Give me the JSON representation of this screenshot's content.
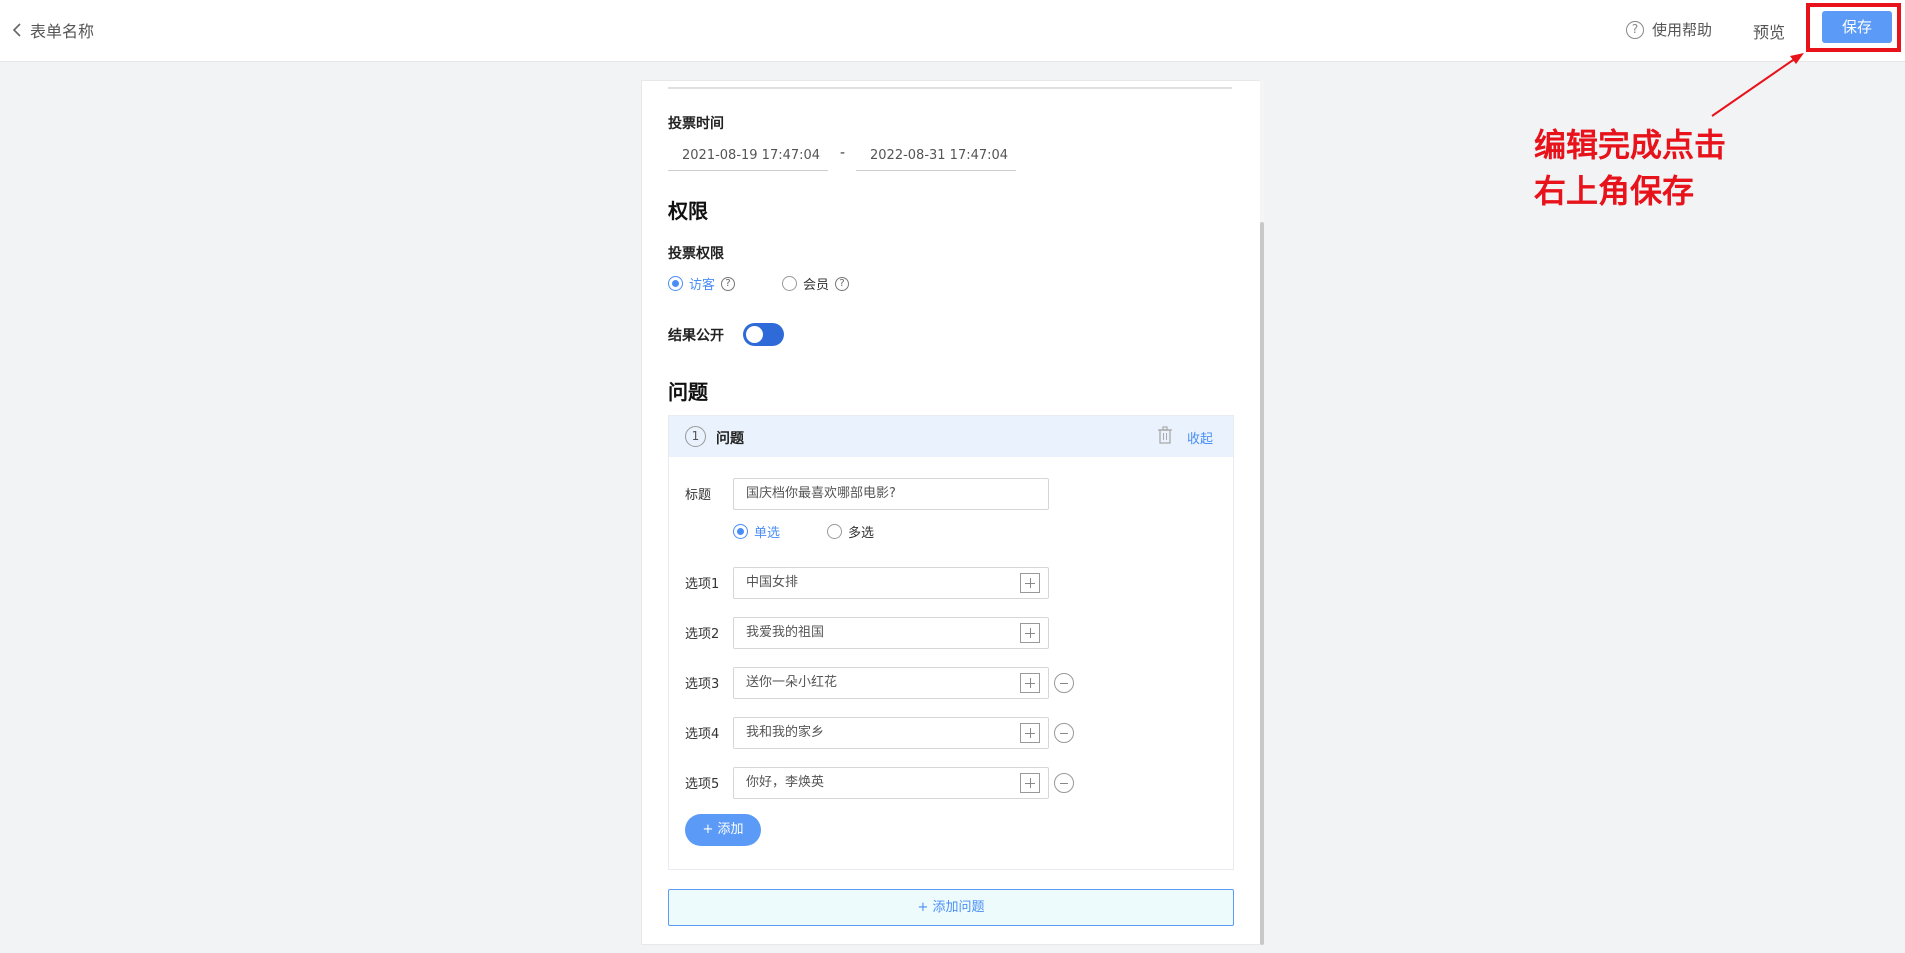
{
  "header": {
    "back_label": "表单名称",
    "help_label": "使用帮助",
    "help_icon_glyph": "?",
    "preview_label": "预览",
    "save_label": "保存"
  },
  "annotation": {
    "text": "编辑完成点击\n右上角保存",
    "color": "#e8121b"
  },
  "form": {
    "vote_time": {
      "label": "投票时间",
      "start": "2021-08-19 17:47:04",
      "separator": "-",
      "end": "2022-08-31 17:47:04"
    },
    "permission_section": {
      "title": "权限",
      "vote_permission_label": "投票权限",
      "options": [
        {
          "label": "访客",
          "checked": true
        },
        {
          "label": "会员",
          "checked": false
        }
      ],
      "help_glyph": "?",
      "results_public_label": "结果公开",
      "results_public_on": true
    },
    "question_section": {
      "title": "问题",
      "questions": [
        {
          "number": "1",
          "header_label": "问题",
          "collapse_label": "收起",
          "title_label": "标题",
          "title_value": "国庆档你最喜欢哪部电影?",
          "type_options": [
            {
              "label": "单选",
              "checked": true
            },
            {
              "label": "多选",
              "checked": false
            }
          ],
          "options": [
            {
              "label": "选项1",
              "value": "中国女排"
            },
            {
              "label": "选项2",
              "value": "我爱我的祖国"
            },
            {
              "label": "选项3",
              "value": "送你一朵小红花"
            },
            {
              "label": "选项4",
              "value": "我和我的家乡"
            },
            {
              "label": "选项5",
              "value": "你好，李焕英"
            }
          ],
          "add_option_label": "+ 添加"
        }
      ],
      "add_question_label": "+ 添加问题"
    }
  },
  "colors": {
    "accent": "#4a8ef5",
    "button": "#5b9bf7",
    "toggle_on": "#2f6bd8",
    "highlight_red": "#e8121b"
  }
}
